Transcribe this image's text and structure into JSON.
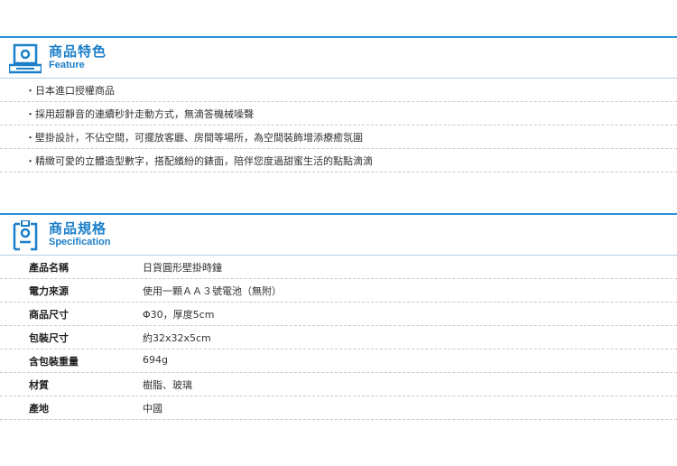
{
  "feature": {
    "title": "商品特色",
    "subtitle": "Feature",
    "items": [
      "・日本進口授權商品",
      "・採用超靜音的連續秒針走動方式，無滴答機械噪聲",
      "・壁掛設計，不佔空間，可擺放客廳、房間等場所，為空間裝飾增添療癒氛圍",
      "・精緻可愛的立體造型數字，搭配繽紛的錶面，陪伴您度過甜蜜生活的點點滴滴"
    ]
  },
  "spec": {
    "title": "商品規格",
    "subtitle": "Specification",
    "rows": [
      {
        "label": "產品名稱",
        "value": "日貨圓形壁掛時鐘"
      },
      {
        "label": "電力來源",
        "value": "使用一顆ＡＡ３號電池（無附）"
      },
      {
        "label": "商品尺寸",
        "value": "Φ30，厚度5cm"
      },
      {
        "label": "包裝尺寸",
        "value": "約32x32x5cm"
      },
      {
        "label": "含包裝重量",
        "value": "694g"
      },
      {
        "label": "材質",
        "value": "樹脂、玻璃"
      },
      {
        "label": "產地",
        "value": "中國"
      }
    ]
  },
  "colors": {
    "accent": "#1b7fc9",
    "rule": "#2a8fd8"
  }
}
